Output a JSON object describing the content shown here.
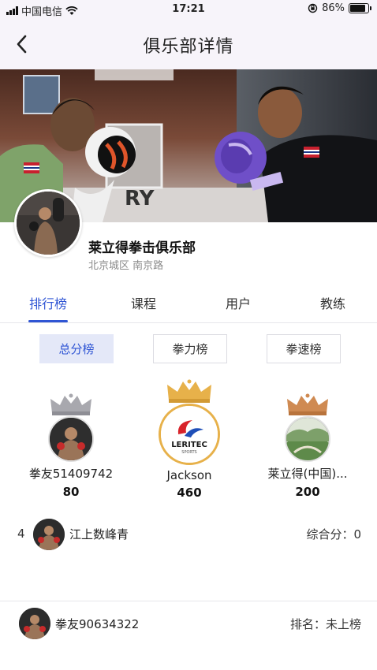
{
  "status_bar": {
    "carrier": "中国电信",
    "time": "17:21",
    "battery": "86%",
    "battery_level": 0.86
  },
  "nav": {
    "title": "俱乐部详情",
    "back_icon": "chevron-left-icon"
  },
  "hero": {
    "sign_text": "RY"
  },
  "club": {
    "name": "莱立得拳击俱乐部",
    "address": "北京城区 南京路"
  },
  "tabs": [
    {
      "label": "排行榜",
      "active": true
    },
    {
      "label": "课程",
      "active": false
    },
    {
      "label": "用户",
      "active": false
    },
    {
      "label": "教练",
      "active": false
    }
  ],
  "board_types": [
    {
      "label": "总分榜",
      "active": true
    },
    {
      "label": "拳力榜",
      "active": false
    },
    {
      "label": "拳速榜",
      "active": false
    }
  ],
  "podium": {
    "first": {
      "name": "Jackson",
      "score": "460",
      "crown": "gold-crown-icon",
      "logo_text": "LERITEC",
      "logo_sub": "SPORTS"
    },
    "second": {
      "name": "拳友51409742",
      "score": "80",
      "crown": "silver-crown-icon"
    },
    "third": {
      "name": "莱立得(中国)...",
      "score": "200",
      "crown": "bronze-crown-icon"
    }
  },
  "ranking": [
    {
      "rank": "4",
      "name": "江上数峰青",
      "score_text": "综合分：0"
    }
  ],
  "my_rank": {
    "name": "拳友90634322",
    "rank_text": "排名：未上榜"
  },
  "colors": {
    "accent": "#2f55d4",
    "gold": "#e7b14a",
    "silver": "#a8a8ae",
    "bronze": "#cf8a52"
  }
}
